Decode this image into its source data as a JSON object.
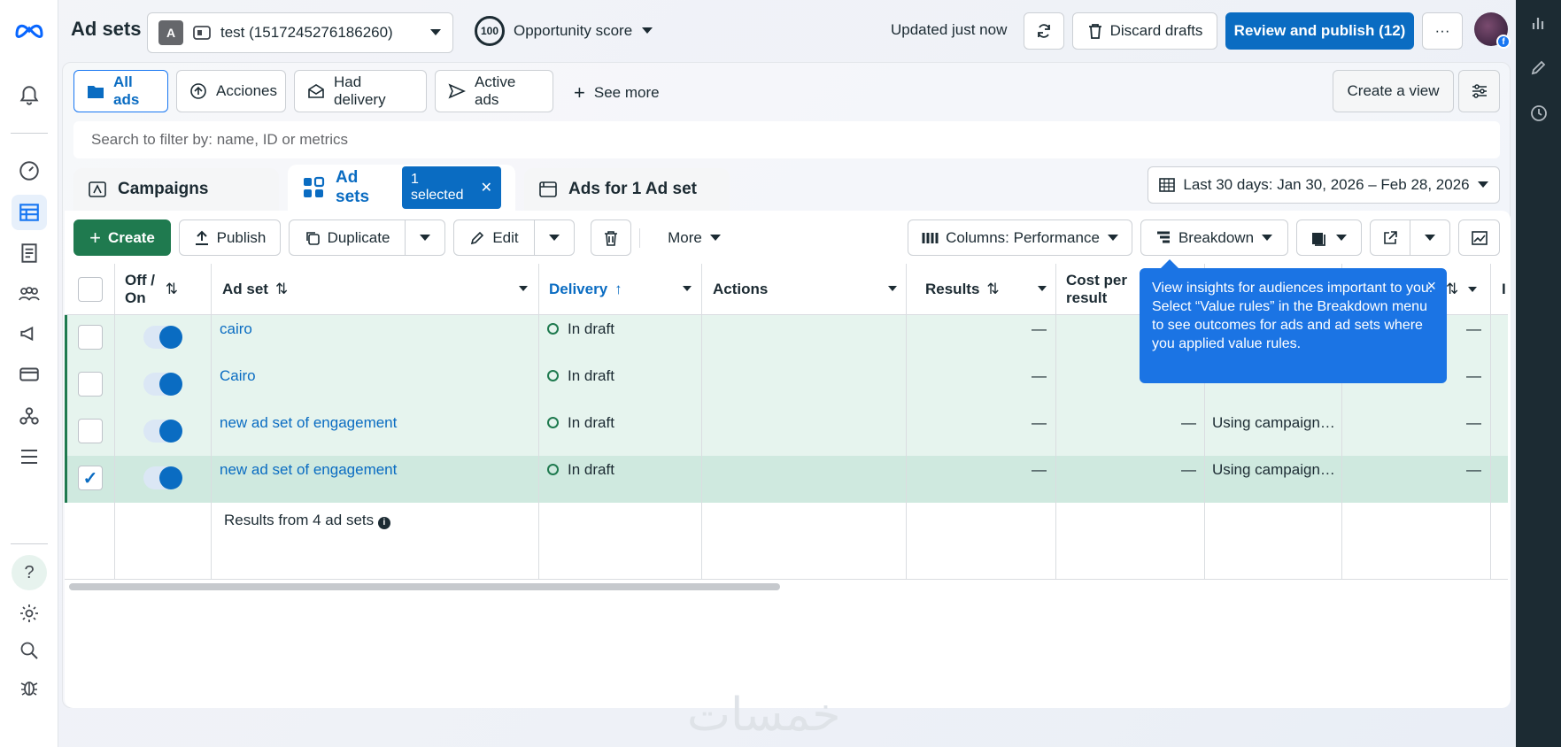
{
  "header": {
    "title": "Ad sets",
    "account_badge": "A",
    "account_name": "test (1517245276186260)",
    "opportunity_value": "100",
    "opportunity_label": "Opportunity score",
    "updated_text": "Updated just now",
    "discard_label": "Discard drafts",
    "review_label": "Review and publish (12)",
    "more_label": "···"
  },
  "filters": {
    "chips": [
      {
        "label": "All ads",
        "icon": "folder-icon"
      },
      {
        "label": "Acciones",
        "icon": "upload-icon"
      },
      {
        "label": "Had delivery",
        "icon": "envelope-icon"
      },
      {
        "label": "Active ads",
        "icon": "send-icon"
      }
    ],
    "see_more": "See more",
    "create_view": "Create a view",
    "search_placeholder": "Search to filter by: name, ID or metrics"
  },
  "tabs": {
    "campaigns": "Campaigns",
    "ad_sets": "Ad sets",
    "selected_badge": "1 selected",
    "ads": "Ads for 1 Ad set"
  },
  "date_range": "Last 30 days: Jan 30, 2026 – Feb 28, 2026",
  "toolbar": {
    "create": "Create",
    "publish": "Publish",
    "duplicate": "Duplicate",
    "edit": "Edit",
    "more": "More",
    "columns": "Columns: Performance",
    "breakdown": "Breakdown"
  },
  "table": {
    "headers": {
      "toggle": "Off / On",
      "ad_set": "Ad set",
      "delivery": "Delivery",
      "actions": "Actions",
      "results": "Results",
      "cost_per_result": "Cost per result",
      "trailing": "I"
    },
    "rows": [
      {
        "name": "cairo",
        "delivery": "In draft",
        "results": "—",
        "cost": "",
        "budget": "",
        "extra": "—",
        "checked": false
      },
      {
        "name": "Cairo",
        "delivery": "In draft",
        "results": "—",
        "cost": "",
        "budget": "",
        "extra": "—",
        "checked": false
      },
      {
        "name": "new ad set of engagement",
        "delivery": "In draft",
        "results": "—",
        "cost": "—",
        "budget": "Using campaign…",
        "extra": "—",
        "checked": false
      },
      {
        "name": "new ad set of engagement",
        "delivery": "In draft",
        "results": "—",
        "cost": "—",
        "budget": "Using campaign…",
        "extra": "—",
        "checked": true
      }
    ],
    "footer": "Results from 4 ad sets"
  },
  "tooltip": {
    "text": "View insights for audiences important to you. Select “Value rules” in the Breakdown menu to see outcomes for ads and ad sets where you applied value rules.",
    "close": "×"
  },
  "watermark": "خمسات",
  "colors": {
    "primary": "#0a6cc2",
    "create_green": "#1f7a4f",
    "row_highlight": "#e6f4ee",
    "tooltip_blue": "#1b74e4"
  }
}
